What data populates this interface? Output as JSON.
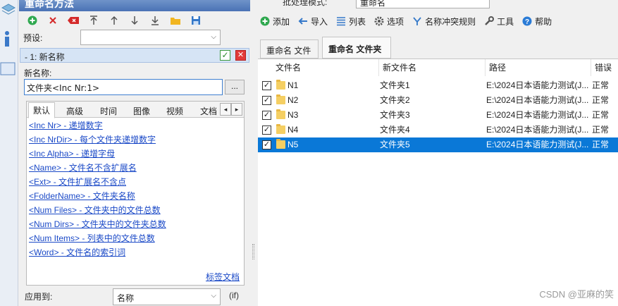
{
  "left_panel": {
    "title": "重命名方法",
    "toolbar_icons": [
      "add-icon",
      "delete-icon",
      "clear-icon",
      "move-top-icon",
      "move-up-icon",
      "move-down-icon",
      "move-bottom-icon",
      "open-folder-icon",
      "save-icon"
    ],
    "preset_label": "预设:",
    "preset_value": "",
    "method_item": "- 1: 新名称",
    "new_name_label": "新名称:",
    "new_name_value": "文件夹<Inc Nr:1>",
    "browse_button": "...",
    "tabs": [
      "默认",
      "高级",
      "时间",
      "图像",
      "视频",
      "文档"
    ],
    "tags": [
      "<Inc Nr> - 递增数字",
      "<Inc NrDir> - 每个文件夹递增数字",
      "<Inc Alpha> - 递增字母",
      "<Name> - 文件名不含扩展名",
      "<Ext> - 文件扩展名不含点",
      "<FolderName> - 文件夹名称",
      "<Num Files> - 文件夹中的文件总数",
      "<Num Dirs> - 文件夹中的文件夹总数",
      "<Num Items> - 列表中的文件总数",
      "<Word> - 文件名的索引词"
    ],
    "docs_link": "标签文档",
    "apply_label": "应用到:",
    "apply_value": "名称",
    "if_label": "(if)"
  },
  "right_panel": {
    "mode_label": "批处理模式:",
    "mode_value": "重命名",
    "menu": [
      {
        "label": "添加",
        "icon": "add-icon"
      },
      {
        "label": "导入",
        "icon": "import-icon"
      },
      {
        "label": "列表",
        "icon": "list-icon"
      },
      {
        "label": "选项",
        "icon": "gear-icon"
      },
      {
        "label": "名称冲突规则",
        "icon": "conflict-icon"
      },
      {
        "label": "工具",
        "icon": "wrench-icon"
      },
      {
        "label": "帮助",
        "icon": "help-icon"
      }
    ],
    "tabs": [
      "重命名 文件",
      "重命名 文件夹"
    ],
    "columns": [
      "文件名",
      "新文件名",
      "路径",
      "错误"
    ],
    "rows": [
      {
        "name": "N1",
        "new_name": "文件夹1",
        "path": "E:\\2024日本语能力测试(J...",
        "error": "正常",
        "checked": true,
        "selected": false
      },
      {
        "name": "N2",
        "new_name": "文件夹2",
        "path": "E:\\2024日本语能力测试(J...",
        "error": "正常",
        "checked": true,
        "selected": false
      },
      {
        "name": "N3",
        "new_name": "文件夹3",
        "path": "E:\\2024日本语能力测试(J...",
        "error": "正常",
        "checked": true,
        "selected": false
      },
      {
        "name": "N4",
        "new_name": "文件夹4",
        "path": "E:\\2024日本语能力测试(J...",
        "error": "正常",
        "checked": true,
        "selected": false
      },
      {
        "name": "N5",
        "new_name": "文件夹5",
        "path": "E:\\2024日本语能力测试(J...",
        "error": "正常",
        "checked": true,
        "selected": true
      }
    ]
  },
  "watermark": "CSDN @亚麻的笑",
  "colors": {
    "selection": "#0a78d7",
    "link": "#1a49c7"
  }
}
